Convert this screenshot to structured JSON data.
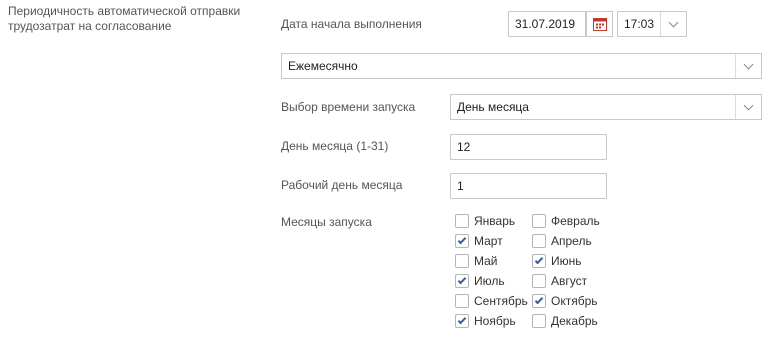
{
  "section": {
    "title": "Периодичность автоматической отправки трудозатрат на согласование"
  },
  "start": {
    "label": "Дата начала выполнения",
    "date": "31.07.2019",
    "time": "17:03"
  },
  "frequency": {
    "selected": "Ежемесячно"
  },
  "launch_time_choice": {
    "label": "Выбор времени запуска",
    "selected": "День месяца"
  },
  "day_of_month": {
    "label": "День месяца (1-31)",
    "value": "12"
  },
  "working_day": {
    "label": "Рабочий день месяца",
    "value": "1"
  },
  "months": {
    "label": "Месяцы запуска",
    "items": [
      {
        "label": "Январь",
        "checked": false
      },
      {
        "label": "Февраль",
        "checked": false
      },
      {
        "label": "Март",
        "checked": true
      },
      {
        "label": "Апрель",
        "checked": false
      },
      {
        "label": "Май",
        "checked": false
      },
      {
        "label": "Июнь",
        "checked": true
      },
      {
        "label": "Июль",
        "checked": true
      },
      {
        "label": "Август",
        "checked": false
      },
      {
        "label": "Сентябрь",
        "checked": false
      },
      {
        "label": "Октябрь",
        "checked": true
      },
      {
        "label": "Ноябрь",
        "checked": true
      },
      {
        "label": "Декабрь",
        "checked": false
      }
    ]
  },
  "colors": {
    "calendar_icon": "#c0392b",
    "checkmark": "#2f5e9e",
    "border": "#c8c8c8"
  }
}
